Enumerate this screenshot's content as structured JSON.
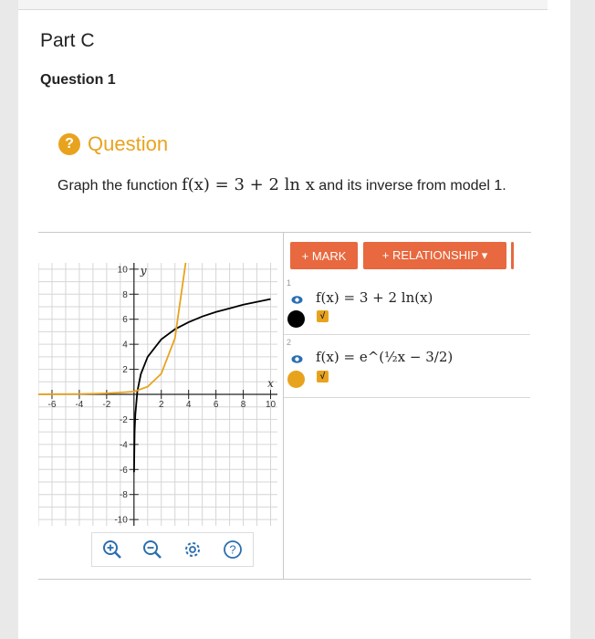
{
  "part": {
    "title": "Part C"
  },
  "question": {
    "number_label": "Question 1",
    "header_label": "Question",
    "header_icon": "?",
    "icon_color": "#e8a31e"
  },
  "prompt": {
    "before": "Graph the function ",
    "math": "f(x) = 3 + 2 ln x",
    "after": " and its inverse from model 1."
  },
  "toolbar": {
    "mark_label": "+ MARK",
    "relationship_label": "+ RELATIONSHIP ▾",
    "button_color": "#e8683f"
  },
  "relationships": [
    {
      "index": "1",
      "expression": "f(x) = 3 + 2 ln(x)",
      "color": "#000000",
      "check": "√"
    },
    {
      "index": "2",
      "expression": "f(x) = e^(½x − 3/2)",
      "color": "#e8a31e",
      "check": "√"
    }
  ],
  "chart_data": {
    "type": "line",
    "xlabel": "x",
    "ylabel": "y",
    "xlim": [
      -7,
      10.5
    ],
    "ylim": [
      -10.5,
      10.5
    ],
    "x_ticks": [
      -6,
      -4,
      -2,
      2,
      4,
      6,
      8,
      10
    ],
    "y_ticks": [
      10,
      8,
      6,
      4,
      2,
      -2,
      -4,
      -6,
      -8,
      -10
    ],
    "grid": true,
    "series": [
      {
        "name": "f(x) = 3 + 2 ln(x)",
        "color": "#000000",
        "x": [
          0.01,
          0.05,
          0.1,
          0.25,
          0.5,
          1,
          2,
          3,
          4,
          5,
          6,
          8,
          10
        ],
        "y": [
          -6.21,
          -2.99,
          -1.61,
          0.23,
          1.61,
          3,
          4.39,
          5.2,
          5.77,
          6.22,
          6.58,
          7.16,
          7.61
        ]
      },
      {
        "name": "f(x) = e^(½x − 3/2)",
        "color": "#e8a31e",
        "x": [
          -7,
          -6,
          -4,
          -2,
          0,
          1,
          2,
          3,
          4,
          5,
          6,
          7,
          7.3
        ],
        "y": [
          0.007,
          0.011,
          0.03,
          0.08,
          0.22,
          0.61,
          1.65,
          4.48,
          12.18,
          33.12,
          90.02,
          244.69,
          285.0
        ]
      }
    ]
  }
}
